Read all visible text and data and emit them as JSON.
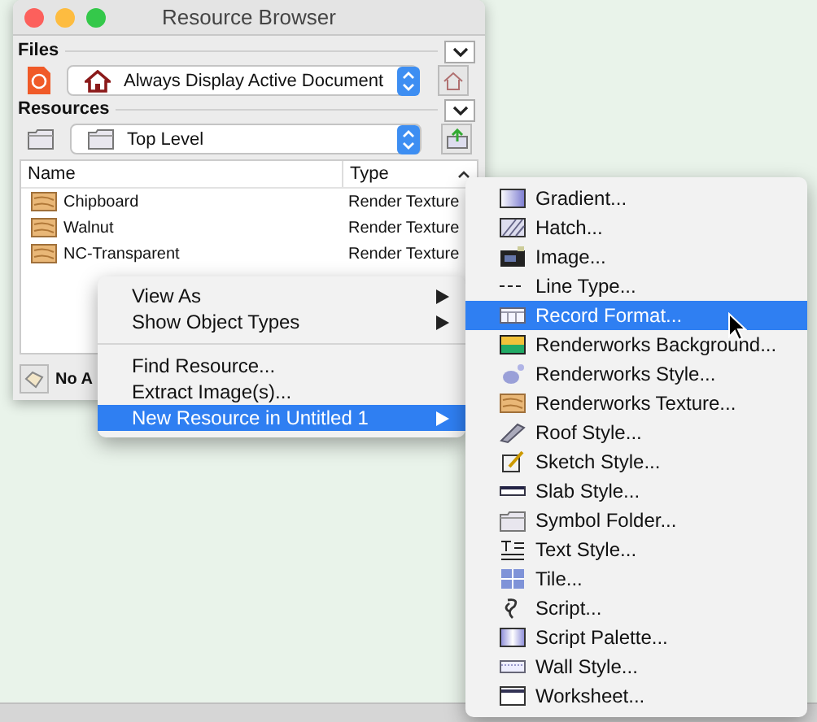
{
  "window": {
    "title": "Resource Browser"
  },
  "files": {
    "heading": "Files",
    "popup": "Always Display Active Document"
  },
  "resources": {
    "heading": "Resources",
    "popup": "Top Level"
  },
  "list": {
    "columns": [
      "Name",
      "Type"
    ],
    "rows": [
      {
        "name": "Chipboard",
        "type": "Render Texture"
      },
      {
        "name": "Walnut",
        "type": "Render Texture"
      },
      {
        "name": "NC-Transparent",
        "type": "Render Texture"
      }
    ]
  },
  "footer": {
    "label": "No A"
  },
  "context_menu": {
    "groups": [
      [
        {
          "label": "View As",
          "has_submenu": true,
          "selected": false
        },
        {
          "label": "Show Object Types",
          "has_submenu": true,
          "selected": false
        }
      ],
      [
        {
          "label": "Find Resource...",
          "has_submenu": false,
          "selected": false
        },
        {
          "label": "Extract Image(s)...",
          "has_submenu": false,
          "selected": false
        },
        {
          "label": "New Resource in Untitled 1",
          "has_submenu": true,
          "selected": true
        }
      ]
    ]
  },
  "submenu": {
    "items": [
      {
        "label": "Gradient...",
        "selected": false
      },
      {
        "label": "Hatch...",
        "selected": false
      },
      {
        "label": "Image...",
        "selected": false
      },
      {
        "label": "Line Type...",
        "selected": false
      },
      {
        "label": "Record Format...",
        "selected": true
      },
      {
        "label": "Renderworks Background...",
        "selected": false
      },
      {
        "label": "Renderworks Style...",
        "selected": false
      },
      {
        "label": "Renderworks Texture...",
        "selected": false
      },
      {
        "label": "Roof Style...",
        "selected": false
      },
      {
        "label": "Sketch Style...",
        "selected": false
      },
      {
        "label": "Slab Style...",
        "selected": false
      },
      {
        "label": "Symbol Folder...",
        "selected": false
      },
      {
        "label": "Text Style...",
        "selected": false
      },
      {
        "label": "Tile...",
        "selected": false
      },
      {
        "label": "Script...",
        "selected": false
      },
      {
        "label": "Script Palette...",
        "selected": false
      },
      {
        "label": "Wall Style...",
        "selected": false
      },
      {
        "label": "Worksheet...",
        "selected": false
      }
    ]
  }
}
